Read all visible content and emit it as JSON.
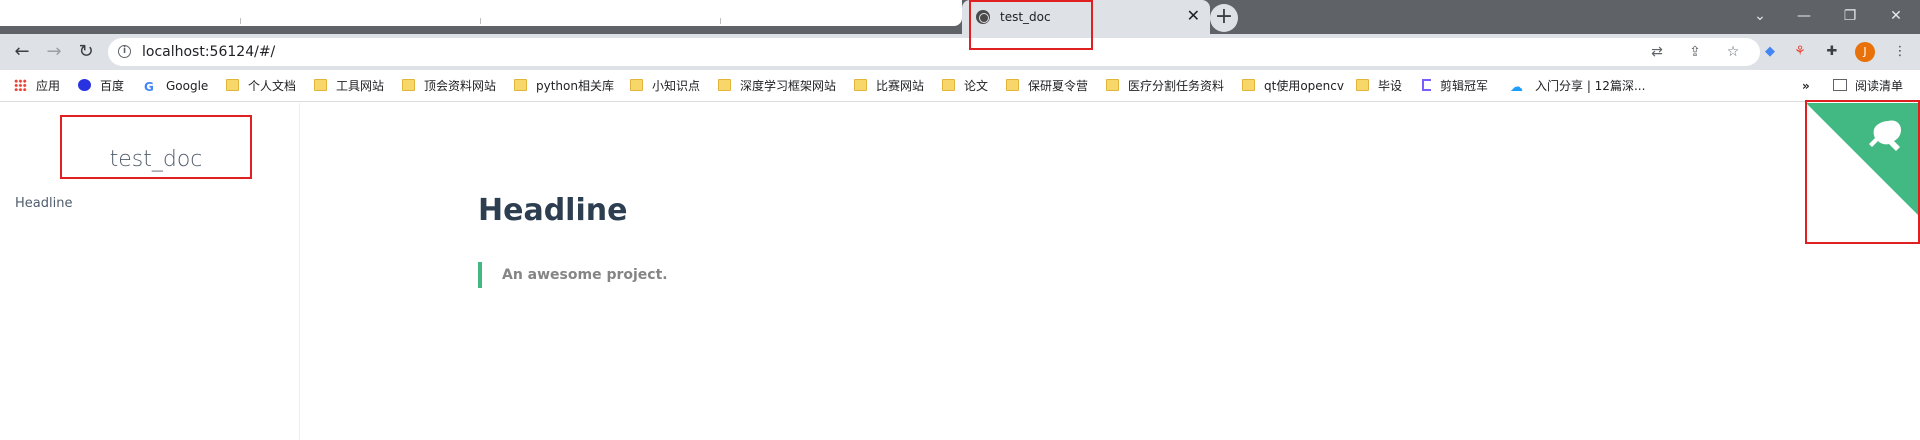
{
  "browser": {
    "tab_title": "test_doc",
    "tab_close": "✕",
    "new_tab": "+",
    "url": "localhost:56124/#/",
    "profile_initial": "J"
  },
  "bookmarks": [
    {
      "label": "应用",
      "icon": "apps-grid-icon"
    },
    {
      "label": "百度",
      "icon": "baidu-paw-icon"
    },
    {
      "label": "Google",
      "icon": "google-g-icon"
    },
    {
      "label": "个人文档",
      "icon": "folder-icon"
    },
    {
      "label": "工具网站",
      "icon": "folder-icon"
    },
    {
      "label": "顶会资料网站",
      "icon": "folder-icon"
    },
    {
      "label": "python相关库",
      "icon": "folder-icon"
    },
    {
      "label": "小知识点",
      "icon": "folder-icon"
    },
    {
      "label": "深度学习框架网站",
      "icon": "folder-icon"
    },
    {
      "label": "比赛网站",
      "icon": "folder-icon"
    },
    {
      "label": "论文",
      "icon": "folder-icon"
    },
    {
      "label": "保研夏令营",
      "icon": "folder-icon"
    },
    {
      "label": "医疗分割任务资料",
      "icon": "folder-icon"
    },
    {
      "label": "qt使用opencv",
      "icon": "folder-icon"
    },
    {
      "label": "毕设",
      "icon": "folder-icon"
    },
    {
      "label": "剪辑冠军",
      "icon": "bracket-icon"
    },
    {
      "label": "入门分享 | 12篇深...",
      "icon": "cloud-icon"
    }
  ],
  "bookmarks_overflow": "»",
  "reading_list": "阅读清单",
  "sidebar": {
    "app_name": "test_doc",
    "items": [
      "Headline"
    ]
  },
  "main": {
    "headline": "Headline",
    "quote": "An awesome project."
  },
  "colors": {
    "accent": "#42b983",
    "annotation": "#e02020"
  }
}
